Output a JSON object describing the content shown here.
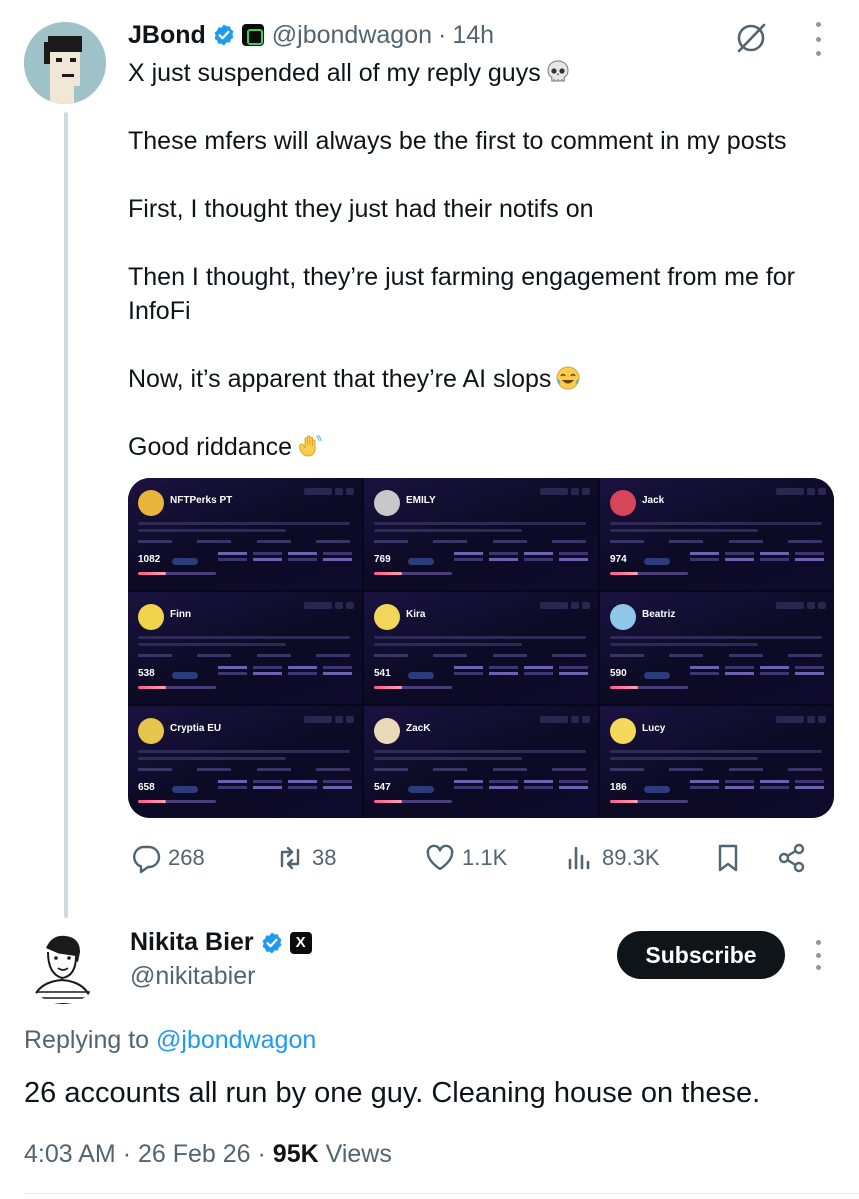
{
  "tweet": {
    "author_name": "JBond",
    "handle": "@jbondwagon",
    "separator": "·",
    "time": "14h",
    "paragraphs": [
      "X just suspended all of my reply guys",
      "These mfers will always be the first to comment in my posts",
      "First, I thought they just had their notifs on",
      "Then I thought, they’re just farming engagement from me for InfoFi",
      "Now, it’s apparent that they’re AI slops",
      "Good riddance"
    ],
    "media_cards": [
      {
        "name": "NFTPerks PT",
        "score": "1082",
        "avatar_color": "#e8b63a"
      },
      {
        "name": "EMILY",
        "score": "769",
        "avatar_color": "#c8c8c8"
      },
      {
        "name": "Jack",
        "score": "974",
        "avatar_color": "#d6455a"
      },
      {
        "name": "Finn",
        "score": "538",
        "avatar_color": "#f3d34a"
      },
      {
        "name": "Kira",
        "score": "541",
        "avatar_color": "#f1d65a"
      },
      {
        "name": "Beatriz",
        "score": "590",
        "avatar_color": "#8ec7e8"
      },
      {
        "name": "Cryptia EU",
        "score": "658",
        "avatar_color": "#e5c64b"
      },
      {
        "name": "ZacK",
        "score": "547",
        "avatar_color": "#e9d9b8"
      },
      {
        "name": "Lucy",
        "score": "186",
        "avatar_color": "#f4d95a"
      }
    ],
    "actions": {
      "replies": "268",
      "reposts": "38",
      "likes": "1.1K",
      "views": "89.3K"
    },
    "icons": [
      "grok-icon",
      "more-icon",
      "reply-icon",
      "repost-icon",
      "like-icon",
      "views-icon",
      "bookmark-icon",
      "share-icon"
    ]
  },
  "reply": {
    "author_name": "Nikita Bier",
    "badge_letter": "X",
    "handle": "@nikitabier",
    "subscribe_label": "Subscribe",
    "replying_prefix": "Replying to",
    "replying_handle": "@jbondwagon",
    "text": "26 accounts all run by one guy. Cleaning house on these.",
    "time": "4:03 AM",
    "separator": "·",
    "date": "26 Feb 26",
    "views_count": "95K",
    "views_label": "Views"
  },
  "colors": {
    "verified_blue": "#1d9bf0",
    "muted_text": "#536471",
    "primary_text": "#0f1419",
    "media_bg": "#08061a"
  }
}
